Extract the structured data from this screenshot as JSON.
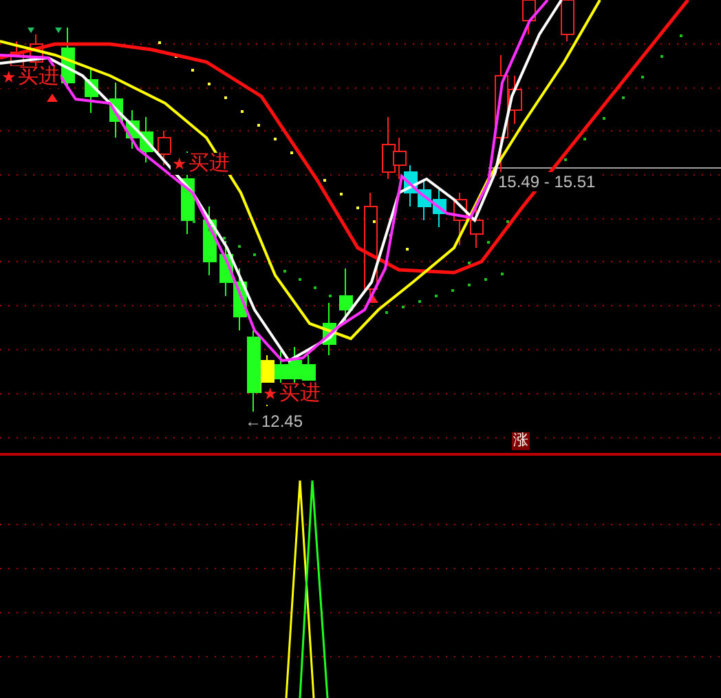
{
  "signals": [
    {
      "mark": "★",
      "label": "买进"
    },
    {
      "mark": "★",
      "label": "买进"
    },
    {
      "mark": "★",
      "label": "买进"
    }
  ],
  "low_marker": {
    "arrow": "←",
    "price": "12.45"
  },
  "range_label": "15.49 - 15.51",
  "badge": "涨"
}
